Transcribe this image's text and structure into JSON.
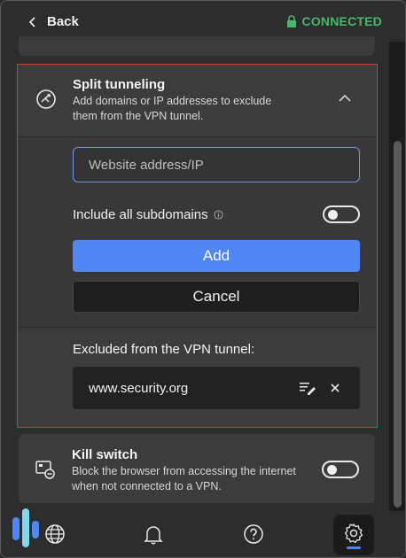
{
  "header": {
    "back_label": "Back",
    "status_label": "CONNECTED"
  },
  "split_tunneling": {
    "title": "Split tunneling",
    "description": "Add domains or IP addresses to exclude them from the VPN tunnel.",
    "input_placeholder": "Website address/IP",
    "input_value": "",
    "subdomains_label": "Include all subdomains",
    "subdomains_toggle_on": false,
    "add_label": "Add",
    "cancel_label": "Cancel",
    "excluded_heading": "Excluded from the VPN tunnel:",
    "excluded_items": [
      "www.security.org"
    ]
  },
  "kill_switch": {
    "title": "Kill switch",
    "description": "Block the browser from accessing the internet when not connected to a VPN.",
    "toggle_on": false
  },
  "nav": {
    "items": [
      "globe-icon",
      "bell-icon",
      "help-icon",
      "settings-icon"
    ],
    "active": "settings-icon"
  },
  "colors": {
    "accent": "#4f87f5",
    "connected": "#49b86a",
    "highlight_border": "#d23a35",
    "background": "#2d2d2d"
  }
}
